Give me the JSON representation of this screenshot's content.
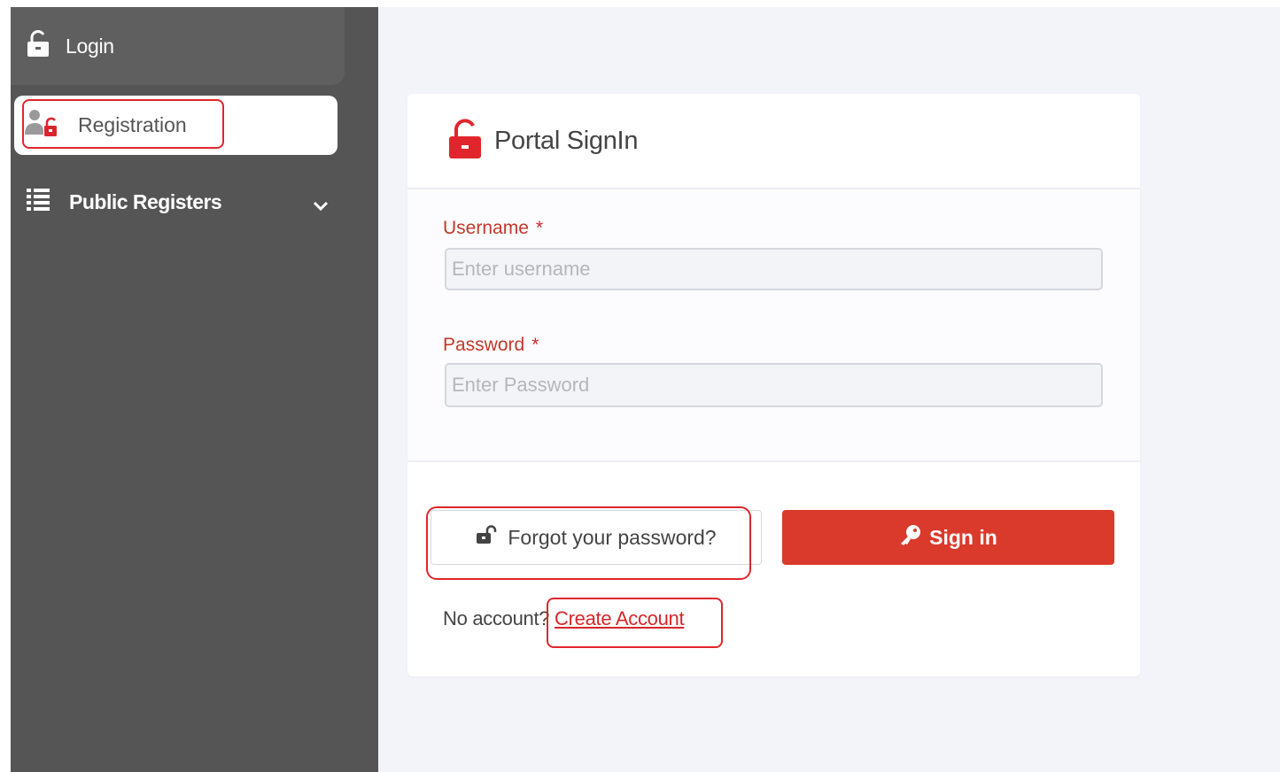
{
  "sidebar": {
    "items": [
      {
        "label": "Login",
        "icon": "unlock-icon"
      },
      {
        "label": "Registration",
        "icon": "user-lock-icon"
      },
      {
        "label": "Public Registers",
        "icon": "list-icon"
      }
    ]
  },
  "card": {
    "title": "Portal SignIn",
    "username": {
      "label": "Username",
      "required_mark": "*",
      "placeholder": "Enter username"
    },
    "password": {
      "label": "Password",
      "required_mark": "*",
      "placeholder": "Enter Password"
    },
    "forgot_label": "Forgot your password?",
    "signin_label": "Sign in",
    "no_account_text": "No account?",
    "create_account_label": "Create Account"
  },
  "colors": {
    "accent": "#d93a2b",
    "sidebar_bg": "#555555",
    "page_bg": "#f3f4fa",
    "highlight": "#e0262c"
  }
}
